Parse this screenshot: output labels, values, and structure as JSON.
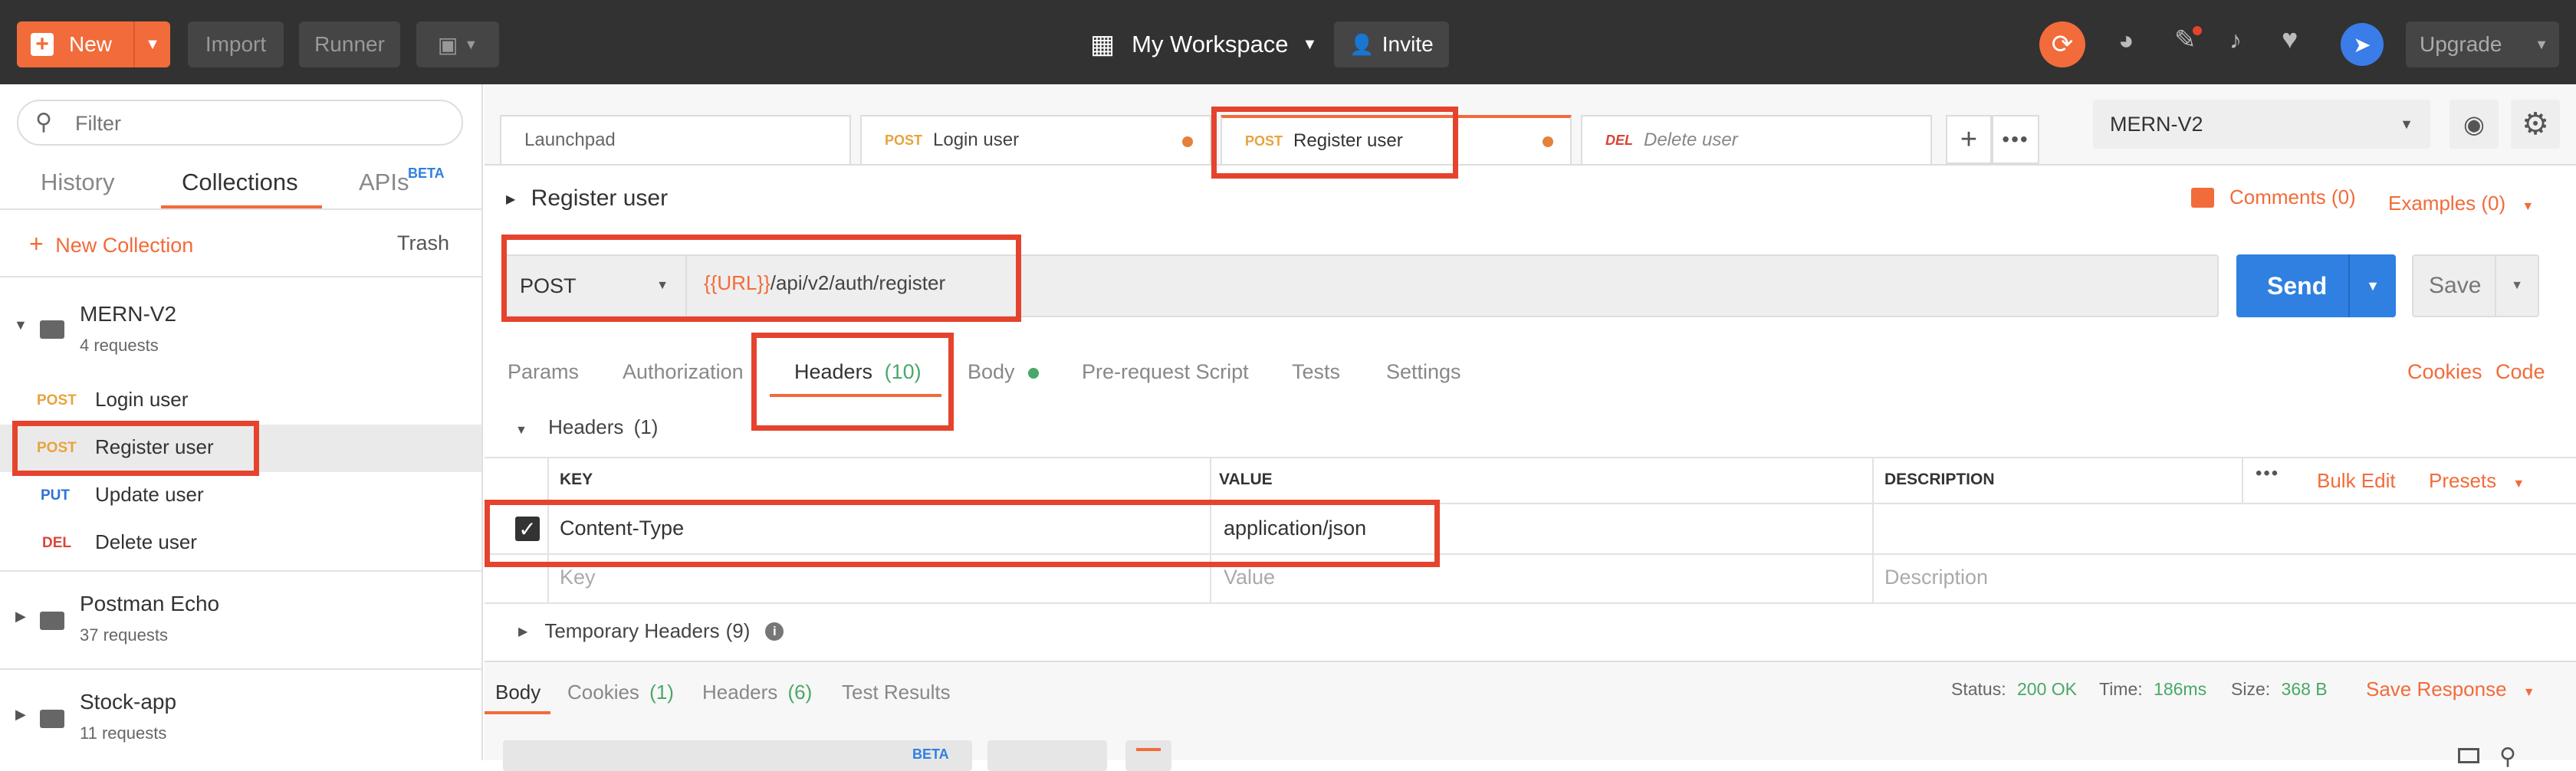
{
  "topbar": {
    "new_label": "New",
    "import_label": "Import",
    "runner_label": "Runner",
    "workspace_label": "My Workspace",
    "invite_label": "Invite",
    "upgrade_label": "Upgrade"
  },
  "sidebar": {
    "filter_placeholder": "Filter",
    "tabs": {
      "history": "History",
      "collections": "Collections",
      "apis": "APIs",
      "apis_badge": "BETA"
    },
    "new_collection": "New Collection",
    "trash": "Trash",
    "collections": [
      {
        "name": "MERN-V2",
        "count": "4 requests"
      },
      {
        "name": "Postman Echo",
        "count": "37 requests"
      },
      {
        "name": "Stock-app",
        "count": "11 requests"
      }
    ],
    "requests": [
      {
        "method": "POST",
        "name": "Login user"
      },
      {
        "method": "POST",
        "name": "Register user"
      },
      {
        "method": "PUT",
        "name": "Update user"
      },
      {
        "method": "DEL",
        "name": "Delete user"
      }
    ]
  },
  "tabs": [
    {
      "label": "Launchpad"
    },
    {
      "method": "POST",
      "label": "Login user"
    },
    {
      "method": "POST",
      "label": "Register user"
    },
    {
      "method": "DEL",
      "label": "Delete user"
    }
  ],
  "environment": {
    "selected": "MERN-V2"
  },
  "request": {
    "title": "Register user",
    "comments": "Comments (0)",
    "examples": "Examples (0)",
    "method": "POST",
    "url_var": "{{URL}}",
    "url_path": "/api/v2/auth/register",
    "send": "Send",
    "save": "Save"
  },
  "request_tabs": {
    "params": "Params",
    "authorization": "Authorization",
    "headers": "Headers",
    "headers_count": "(10)",
    "body": "Body",
    "prerequest": "Pre-request Script",
    "tests": "Tests",
    "settings": "Settings",
    "cookies": "Cookies",
    "code": "Code"
  },
  "headers_section": {
    "title": "Headers",
    "count": "(1)",
    "columns": {
      "key": "KEY",
      "value": "VALUE",
      "description": "DESCRIPTION"
    },
    "bulk_edit": "Bulk Edit",
    "presets": "Presets",
    "rows": [
      {
        "key": "Content-Type",
        "value": "application/json",
        "checked": true
      }
    ],
    "placeholders": {
      "key": "Key",
      "value": "Value",
      "description": "Description"
    },
    "temporary": "Temporary Headers",
    "temporary_count": "(9)"
  },
  "response": {
    "tabs": {
      "body": "Body",
      "cookies": "Cookies",
      "cookies_count": "(1)",
      "headers": "Headers",
      "headers_count": "(6)",
      "tests": "Test Results"
    },
    "status_label": "Status:",
    "status_value": "200 OK",
    "time_label": "Time:",
    "time_value": "186ms",
    "size_label": "Size:",
    "size_value": "368 B",
    "save_response": "Save Response",
    "beta_badge": "BETA"
  },
  "colors": {
    "accent": "#f26b3a",
    "send_blue": "#2f80e0",
    "highlight_red": "#e5432e",
    "topbar": "#323232"
  }
}
